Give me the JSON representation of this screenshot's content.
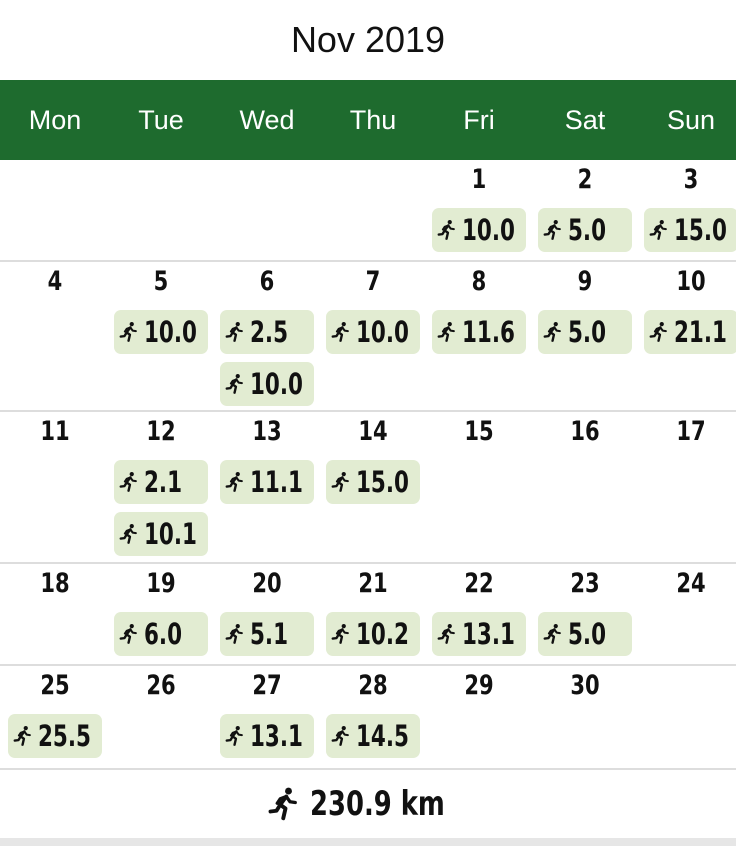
{
  "header": {
    "title": "Nov 2019"
  },
  "weekdays": [
    "Mon",
    "Tue",
    "Wed",
    "Thu",
    "Fri",
    "Sat",
    "Sun"
  ],
  "colors": {
    "weekbar": "#1e6b2e",
    "chip": "#e2ecd2"
  },
  "icons": {
    "entry": "running-person-icon",
    "total": "running-person-icon"
  },
  "weeks": [
    [
      {
        "day": "",
        "runs": []
      },
      {
        "day": "",
        "runs": []
      },
      {
        "day": "",
        "runs": []
      },
      {
        "day": "",
        "runs": []
      },
      {
        "day": "1",
        "runs": [
          "10.0"
        ]
      },
      {
        "day": "2",
        "runs": [
          "5.0"
        ]
      },
      {
        "day": "3",
        "runs": [
          "15.0"
        ]
      }
    ],
    [
      {
        "day": "4",
        "runs": []
      },
      {
        "day": "5",
        "runs": [
          "10.0"
        ]
      },
      {
        "day": "6",
        "runs": [
          "2.5",
          "10.0"
        ]
      },
      {
        "day": "7",
        "runs": [
          "10.0"
        ]
      },
      {
        "day": "8",
        "runs": [
          "11.6"
        ]
      },
      {
        "day": "9",
        "runs": [
          "5.0"
        ]
      },
      {
        "day": "10",
        "runs": [
          "21.1"
        ]
      }
    ],
    [
      {
        "day": "11",
        "runs": []
      },
      {
        "day": "12",
        "runs": [
          "2.1",
          "10.1"
        ]
      },
      {
        "day": "13",
        "runs": [
          "11.1"
        ]
      },
      {
        "day": "14",
        "runs": [
          "15.0"
        ]
      },
      {
        "day": "15",
        "runs": []
      },
      {
        "day": "16",
        "runs": []
      },
      {
        "day": "17",
        "runs": []
      }
    ],
    [
      {
        "day": "18",
        "runs": []
      },
      {
        "day": "19",
        "runs": [
          "6.0"
        ]
      },
      {
        "day": "20",
        "runs": [
          "5.1"
        ]
      },
      {
        "day": "21",
        "runs": [
          "10.2"
        ]
      },
      {
        "day": "22",
        "runs": [
          "13.1"
        ]
      },
      {
        "day": "23",
        "runs": [
          "5.0"
        ]
      },
      {
        "day": "24",
        "runs": []
      }
    ],
    [
      {
        "day": "25",
        "runs": [
          "25.5"
        ]
      },
      {
        "day": "26",
        "runs": []
      },
      {
        "day": "27",
        "runs": [
          "13.1"
        ]
      },
      {
        "day": "28",
        "runs": [
          "14.5"
        ]
      },
      {
        "day": "29",
        "runs": []
      },
      {
        "day": "30",
        "runs": []
      },
      {
        "day": "",
        "runs": []
      }
    ]
  ],
  "footer": {
    "total": "230.9 km"
  }
}
